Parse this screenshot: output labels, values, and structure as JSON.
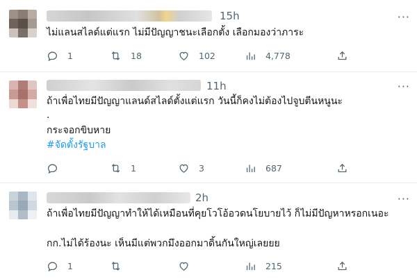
{
  "tweets": [
    {
      "time": "15h",
      "lines": [
        "ไม่แลนสไลด์แต่แรก ไม่มีปัญญาชนะเลือกตั้ง เลือกมองว่าภาระ"
      ],
      "hashtag": "",
      "stats": {
        "reply": "1",
        "retweet": "18",
        "like": "102",
        "views": "4,778"
      }
    },
    {
      "time": "11h",
      "lines": [
        "ถ้าเพื่อไทยมีปัญญาแลนด์สไลด์ตั้งแต่แรก วันนี้ก็คงไม่ต้องไปจูบตีนหนูนะ",
        ".",
        "กระจอกขิบหาย"
      ],
      "hashtag": "#จัดตั้งรัฐบาล",
      "stats": {
        "reply": "",
        "retweet": "1",
        "like": "3",
        "views": "687"
      }
    },
    {
      "time": "2h",
      "lines": [
        "ถ้าเพื่อไทยมีปัญญาทำให้ได้เหมือนที่คุยโวโอ้อวดนโยบายไว้ ก็ไม่มีปัญหาหรอกเนอะ",
        "กก.ไม่ได้ร้องนะ เห็นมีแต่พวกมึงออกมาดิ้นกันใหญ่เลยยย"
      ],
      "hashtag": "",
      "stats": {
        "reply": "1",
        "retweet": "",
        "like": "",
        "views": "215"
      }
    }
  ],
  "more_label": "···",
  "icons": [
    "reply-icon",
    "retweet-icon",
    "like-icon",
    "views-icon",
    "share-icon",
    "more-icon"
  ],
  "colors": {
    "text": "#0f1419",
    "secondary": "#536471",
    "hashtag": "#1d9bf0",
    "divider": "#e6ecf0"
  }
}
